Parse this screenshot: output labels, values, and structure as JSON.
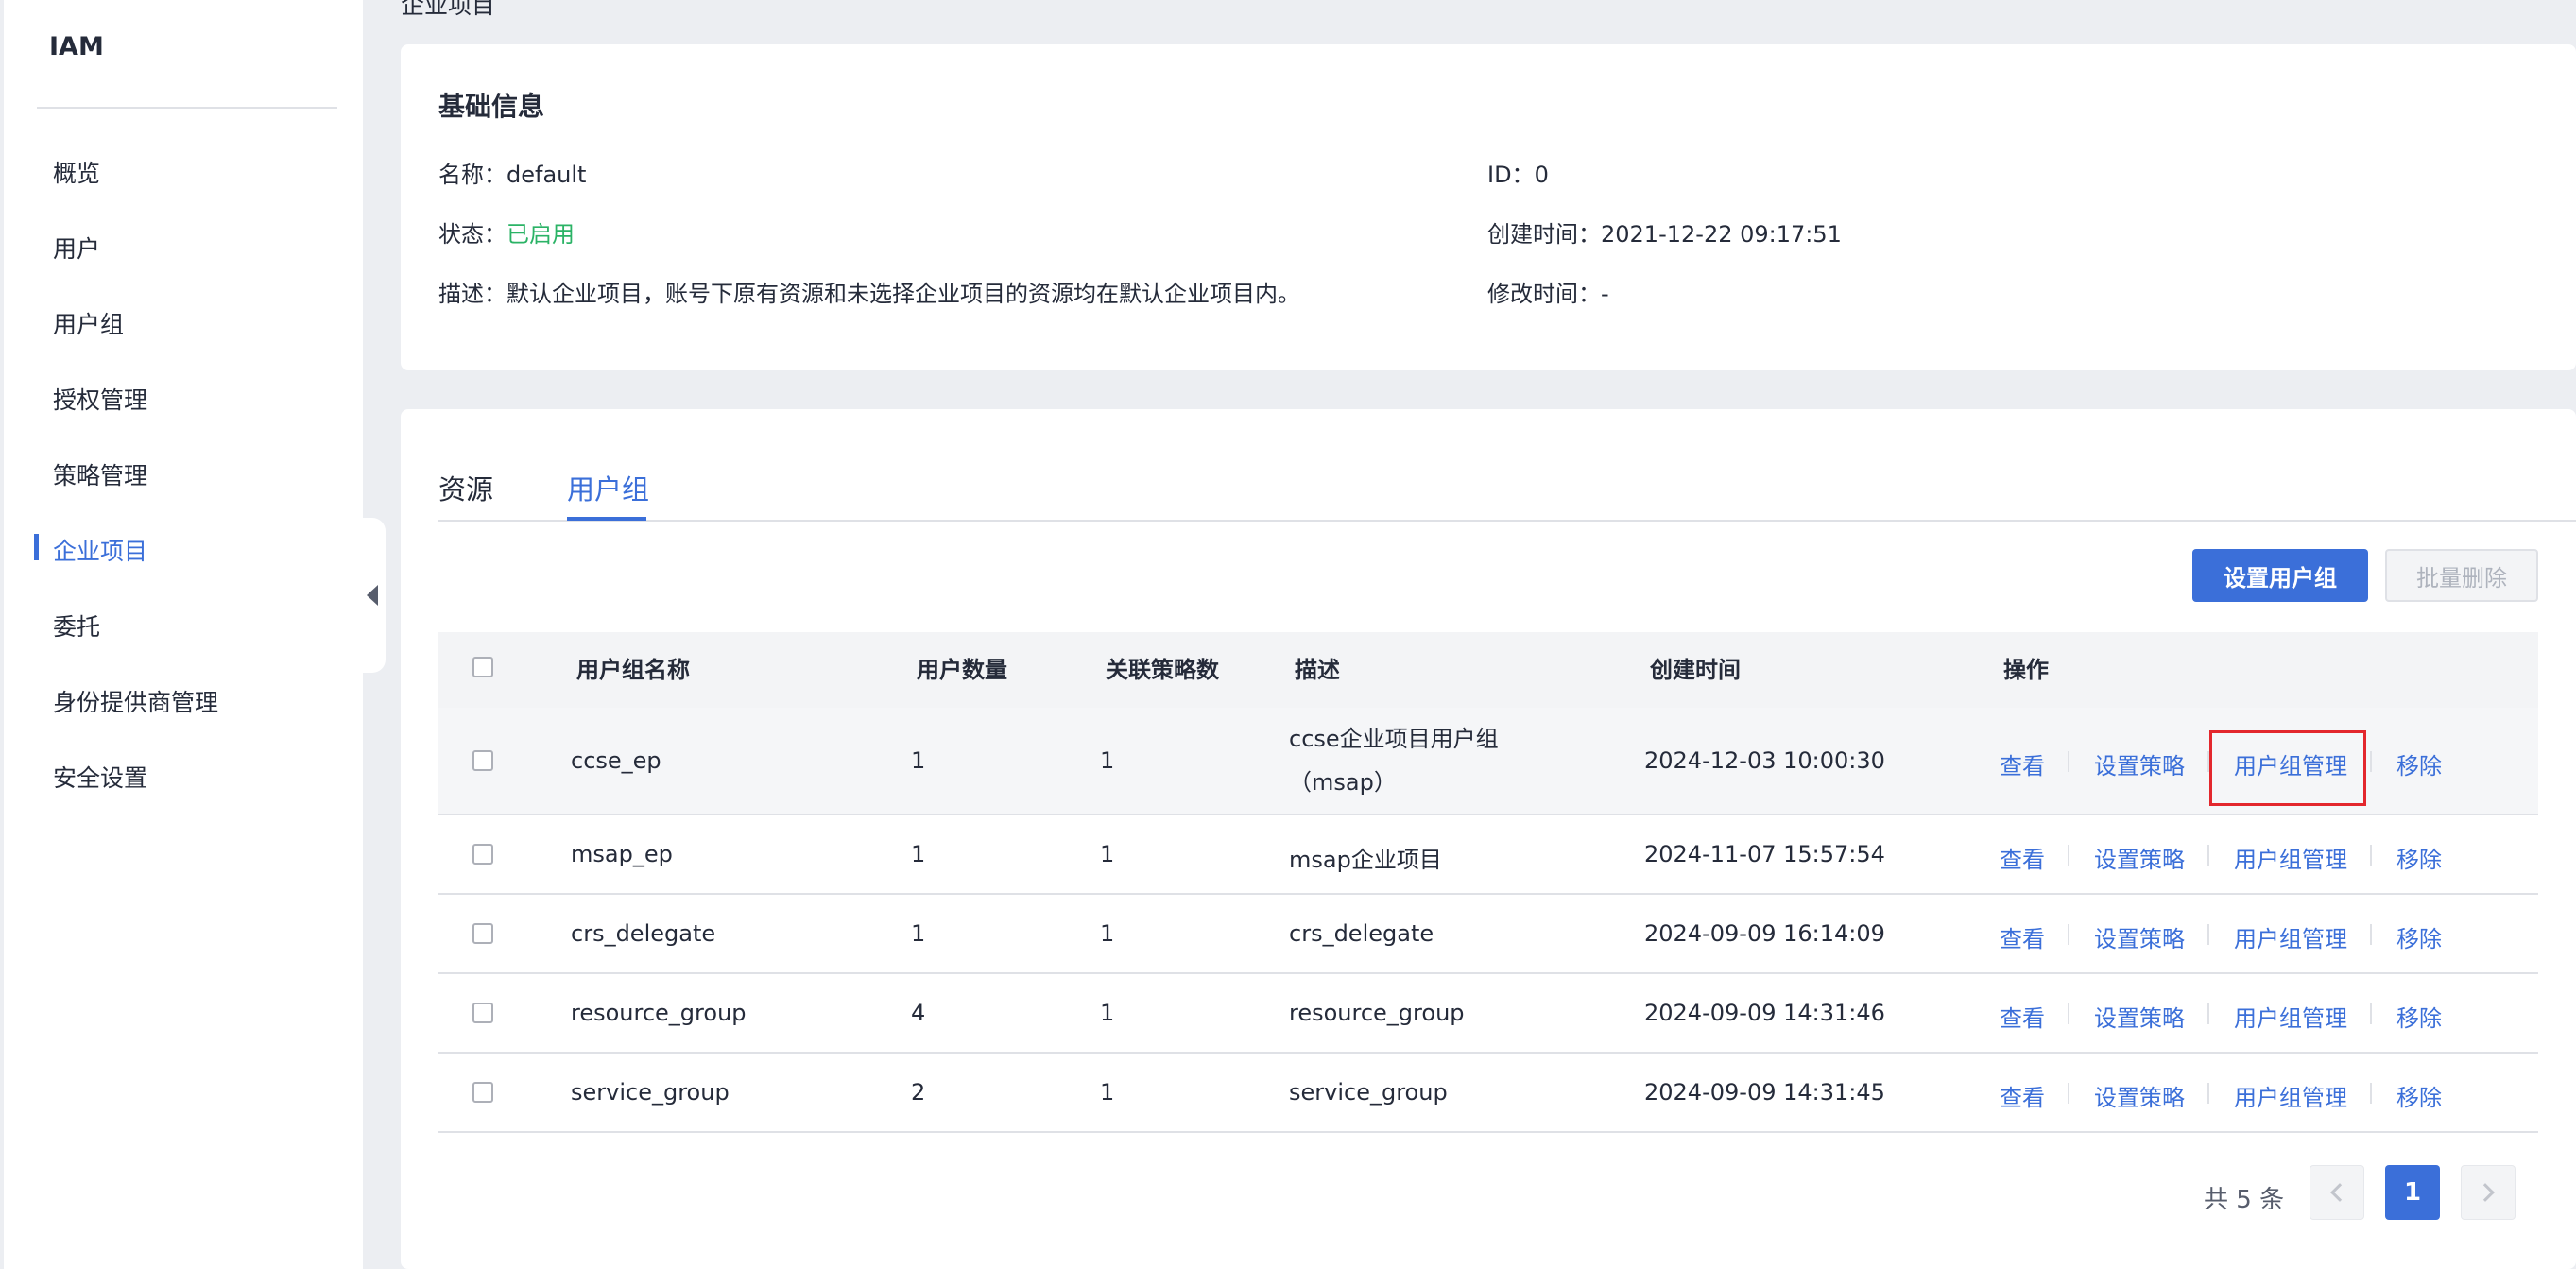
{
  "sidebar": {
    "title": "IAM",
    "items": [
      {
        "label": "概览"
      },
      {
        "label": "用户"
      },
      {
        "label": "用户组"
      },
      {
        "label": "授权管理"
      },
      {
        "label": "策略管理"
      },
      {
        "label": "企业项目"
      },
      {
        "label": "委托"
      },
      {
        "label": "身份提供商管理"
      },
      {
        "label": "安全设置"
      }
    ],
    "active_index": 5
  },
  "page": {
    "cut_heading": "企业项目"
  },
  "basic_info": {
    "title": "基础信息",
    "name_label": "名称：",
    "name_value": "default",
    "status_label": "状态：",
    "status_value": "已启用",
    "desc_label": "描述：",
    "desc_value": "默认企业项目，账号下原有资源和未选择企业项目的资源均在默认企业项目内。",
    "id_label": "ID：",
    "id_value": "0",
    "created_label": "创建时间：",
    "created_value": "2021-12-22 09:17:51",
    "modified_label": "修改时间：",
    "modified_value": "-"
  },
  "tabs": [
    {
      "label": "资源"
    },
    {
      "label": "用户组"
    }
  ],
  "toolbar": {
    "set_group_label": "设置用户组",
    "batch_delete_label": "批量删除"
  },
  "table": {
    "headers": {
      "name": "用户组名称",
      "users": "用户数量",
      "policies": "关联策略数",
      "desc": "描述",
      "created": "创建时间",
      "actions": "操作"
    },
    "rows": [
      {
        "name": "ccse_ep",
        "users": "1",
        "policies": "1",
        "desc": "ccse企业项目用户组（msap）",
        "created": "2024-12-03 10:00:30"
      },
      {
        "name": "msap_ep",
        "users": "1",
        "policies": "1",
        "desc": "msap企业项目",
        "created": "2024-11-07 15:57:54"
      },
      {
        "name": "crs_delegate",
        "users": "1",
        "policies": "1",
        "desc": "crs_delegate",
        "created": "2024-09-09 16:14:09"
      },
      {
        "name": "resource_group",
        "users": "4",
        "policies": "1",
        "desc": "resource_group",
        "created": "2024-09-09 14:31:46"
      },
      {
        "name": "service_group",
        "users": "2",
        "policies": "1",
        "desc": "service_group",
        "created": "2024-09-09 14:31:45"
      }
    ],
    "actions": {
      "view": "查看",
      "set_policy": "设置策略",
      "manage_group": "用户组管理",
      "remove": "移除"
    }
  },
  "pagination": {
    "total_text": "共 5 条",
    "current_page": "1"
  },
  "colors": {
    "accent": "#3b6fd9",
    "status_enabled": "#2bb366",
    "highlight_box": "#e3272d"
  }
}
